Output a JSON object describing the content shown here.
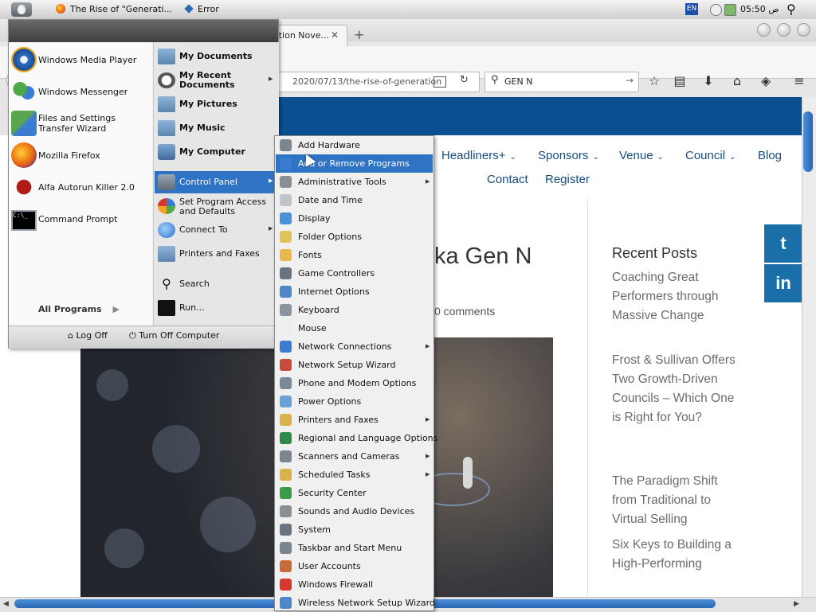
{
  "topbar": {
    "tasks": [
      {
        "label": "The Rise of \"Generati...",
        "icon": "firefox-icon"
      },
      {
        "label": "Error",
        "icon": "error-icon"
      }
    ],
    "lang": "EN",
    "clock": "05:50 ص"
  },
  "browser": {
    "tab_title": "ation Nove...",
    "url": "2020/07/13/the-rise-of-generation",
    "search_value": "GEN N"
  },
  "page": {
    "nav": [
      {
        "label": "Headliners+",
        "dropdown": true
      },
      {
        "label": "Sponsors",
        "dropdown": true
      },
      {
        "label": "Venue",
        "dropdown": true
      },
      {
        "label": "Council",
        "dropdown": true
      },
      {
        "label": "Blog",
        "dropdown": false
      },
      {
        "label": "Contact",
        "dropdown": false
      },
      {
        "label": "Register",
        "dropdown": false
      }
    ],
    "heading_partial": "ka Gen N",
    "comments": "0 comments",
    "recent_posts_title": "Recent Posts",
    "recent_posts": [
      "Coaching Great Performers through Massive Change",
      "Frost & Sullivan Offers Two Growth-Driven Councils – Which One is Right for You?",
      "The Paradigm Shift from Traditional to Virtual Selling",
      "Six Keys to Building a High-Performing"
    ],
    "social": {
      "twitter": "t",
      "linkedin": "in"
    }
  },
  "start_menu": {
    "left_items": [
      {
        "label": "Windows Media Player",
        "icon": "media-player-icon"
      },
      {
        "label": "Windows Messenger",
        "icon": "messenger-icon"
      },
      {
        "label": "Files and Settings Transfer Wizard",
        "icon": "transfer-wizard-icon"
      },
      {
        "label": "Mozilla Firefox",
        "icon": "firefox-icon"
      },
      {
        "label": "Alfa Autorun Killer 2.0",
        "icon": "autorun-killer-icon"
      },
      {
        "label": "Command Prompt",
        "icon": "command-prompt-icon"
      }
    ],
    "all_programs": "All Programs",
    "right_items": [
      {
        "label": "My Documents",
        "bold": true
      },
      {
        "label": "My Recent Documents",
        "bold": true,
        "submenu": true
      },
      {
        "label": "My Pictures",
        "bold": true
      },
      {
        "label": "My Music",
        "bold": true
      },
      {
        "label": "My Computer",
        "bold": true
      },
      {
        "label": "Control Panel",
        "submenu": true,
        "highlighted": true
      },
      {
        "label": "Set Program Access and Defaults"
      },
      {
        "label": "Connect To",
        "submenu": true
      },
      {
        "label": "Printers and Faxes"
      },
      {
        "label": "Search"
      },
      {
        "label": "Run..."
      }
    ],
    "log_off": "Log Off",
    "turn_off": "Turn Off Computer"
  },
  "control_panel_menu": [
    {
      "label": "Add Hardware"
    },
    {
      "label": "Add or Remove Programs",
      "highlighted": true
    },
    {
      "label": "Administrative Tools",
      "submenu": true
    },
    {
      "label": "Date and Time"
    },
    {
      "label": "Display"
    },
    {
      "label": "Folder Options"
    },
    {
      "label": "Fonts"
    },
    {
      "label": "Game Controllers"
    },
    {
      "label": "Internet Options"
    },
    {
      "label": "Keyboard"
    },
    {
      "label": "Mouse"
    },
    {
      "label": "Network Connections",
      "submenu": true
    },
    {
      "label": "Network Setup Wizard"
    },
    {
      "label": "Phone and Modem Options"
    },
    {
      "label": "Power Options"
    },
    {
      "label": "Printers and Faxes",
      "submenu": true
    },
    {
      "label": "Regional and Language Options"
    },
    {
      "label": "Scanners and Cameras",
      "submenu": true
    },
    {
      "label": "Scheduled Tasks",
      "submenu": true
    },
    {
      "label": "Security Center"
    },
    {
      "label": "Sounds and Audio Devices"
    },
    {
      "label": "System"
    },
    {
      "label": "Taskbar and Start Menu"
    },
    {
      "label": "User Accounts"
    },
    {
      "label": "Windows Firewall"
    },
    {
      "label": "Wireless Network Setup Wizard"
    }
  ]
}
